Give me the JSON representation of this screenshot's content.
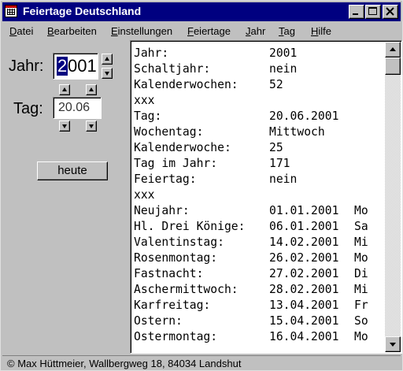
{
  "window": {
    "title": "Feiertage Deutschland"
  },
  "menu": [
    "Datei",
    "Bearbeiten",
    "Einstellungen",
    "Feiertage",
    "Jahr",
    "Tag",
    "Hilfe"
  ],
  "controls": {
    "year_label": "Jahr:",
    "year_value": "2001",
    "year_selected_char": "2",
    "year_rest": "001",
    "day_label": "Tag:",
    "day_value": "20.06",
    "today_button": "heute"
  },
  "output": [
    {
      "key": "Jahr:",
      "value": "2001",
      "day": ""
    },
    {
      "key": "Schaltjahr:",
      "value": "nein",
      "day": ""
    },
    {
      "key": "Kalenderwochen:",
      "value": "52",
      "day": ""
    },
    {
      "key": "xxx",
      "value": "",
      "day": ""
    },
    {
      "key": "Tag:",
      "value": "20.06.2001",
      "day": ""
    },
    {
      "key": "Wochentag:",
      "value": "Mittwoch",
      "day": ""
    },
    {
      "key": "Kalenderwoche:",
      "value": "25",
      "day": ""
    },
    {
      "key": "Tag im Jahr:",
      "value": "171",
      "day": ""
    },
    {
      "key": "Feiertag:",
      "value": "nein",
      "day": ""
    },
    {
      "key": "xxx",
      "value": "",
      "day": ""
    },
    {
      "key": "Neujahr:",
      "value": "01.01.2001",
      "day": "Mo"
    },
    {
      "key": "Hl. Drei Könige:",
      "value": "06.01.2001",
      "day": "Sa"
    },
    {
      "key": "Valentinstag:",
      "value": "14.02.2001",
      "day": "Mi"
    },
    {
      "key": "Rosenmontag:",
      "value": "26.02.2001",
      "day": "Mo"
    },
    {
      "key": "Fastnacht:",
      "value": "27.02.2001",
      "day": "Di"
    },
    {
      "key": "Aschermittwoch:",
      "value": "28.02.2001",
      "day": "Mi"
    },
    {
      "key": "Karfreitag:",
      "value": "13.04.2001",
      "day": "Fr"
    },
    {
      "key": "Ostern:",
      "value": "15.04.2001",
      "day": "So"
    },
    {
      "key": "Ostermontag:",
      "value": "16.04.2001",
      "day": "Mo"
    }
  ],
  "status": {
    "text": "© Max Hüttmeier, Wallbergweg 18, 84034 Landshut"
  },
  "icons": {
    "app": "calendar-icon",
    "minimize": "minimize-icon",
    "maximize": "maximize-icon",
    "close": "close-icon",
    "spin_up": "arrow-up-icon",
    "spin_down": "arrow-down-icon"
  },
  "colors": {
    "titlebar": "#000080",
    "face": "#c0c0c0",
    "selection": "#000080"
  }
}
